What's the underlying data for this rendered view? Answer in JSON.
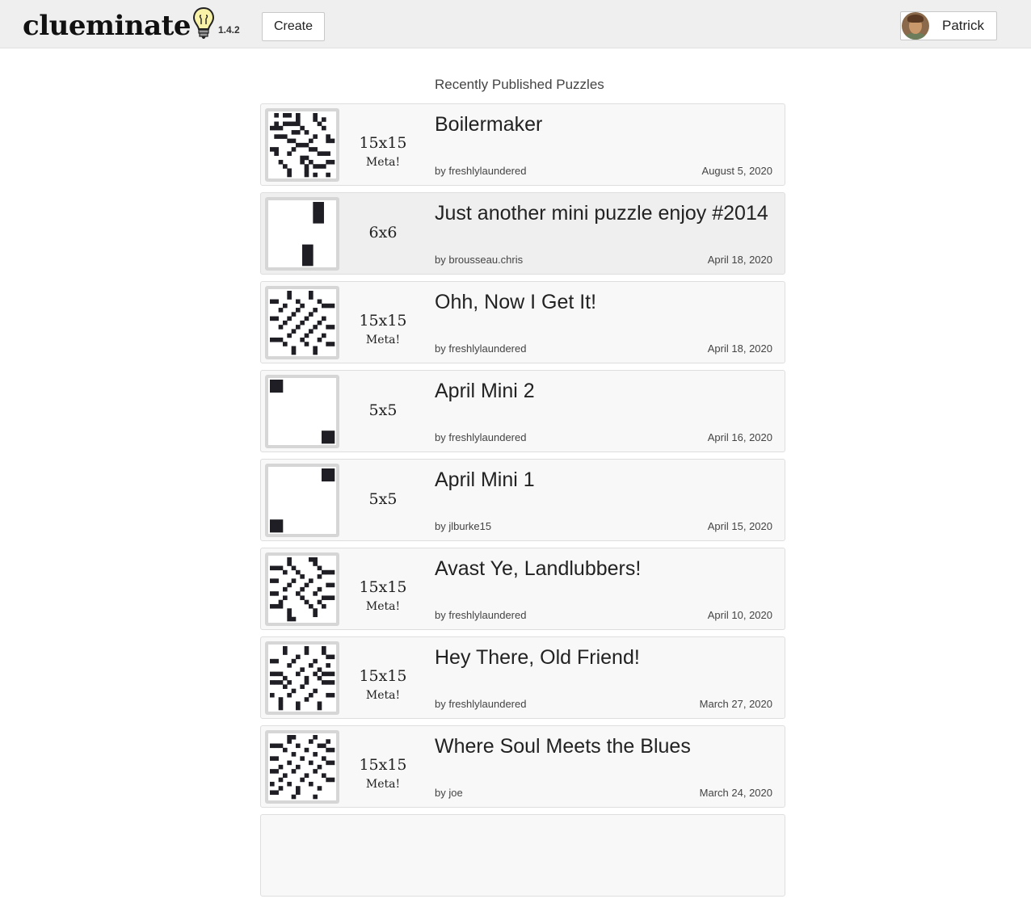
{
  "app": {
    "logo_text": "clueminate",
    "version": "1.4.2",
    "create_label": "Create",
    "user_name": "Patrick"
  },
  "section_title": "Recently Published Puzzles",
  "puzzles": [
    {
      "title": "Boilermaker",
      "size": "15x15",
      "meta": "Meta!",
      "author": "by freshlylaundered",
      "date": "August 5, 2020",
      "grid": 15,
      "pattern": "a"
    },
    {
      "title": "Just another mini puzzle enjoy #2014",
      "size": "6x6",
      "meta": "",
      "author": "by brousseau.chris",
      "date": "April 18, 2020",
      "grid": 6,
      "pattern": "mini6"
    },
    {
      "title": "Ohh, Now I Get It!",
      "size": "15x15",
      "meta": "Meta!",
      "author": "by freshlylaundered",
      "date": "April 18, 2020",
      "grid": 15,
      "pattern": "b"
    },
    {
      "title": "April Mini 2",
      "size": "5x5",
      "meta": "",
      "author": "by freshlylaundered",
      "date": "April 16, 2020",
      "grid": 5,
      "pattern": "mini5a"
    },
    {
      "title": "April Mini 1",
      "size": "5x5",
      "meta": "",
      "author": "by jlburke15",
      "date": "April 15, 2020",
      "grid": 5,
      "pattern": "mini5b"
    },
    {
      "title": "Avast Ye, Landlubbers!",
      "size": "15x15",
      "meta": "Meta!",
      "author": "by freshlylaundered",
      "date": "April 10, 2020",
      "grid": 15,
      "pattern": "c"
    },
    {
      "title": "Hey There, Old Friend!",
      "size": "15x15",
      "meta": "Meta!",
      "author": "by freshlylaundered",
      "date": "March 27, 2020",
      "grid": 15,
      "pattern": "d"
    },
    {
      "title": "Where Soul Meets the Blues",
      "size": "15x15",
      "meta": "Meta!",
      "author": "by joe",
      "date": "March 24, 2020",
      "grid": 15,
      "pattern": "e"
    }
  ]
}
